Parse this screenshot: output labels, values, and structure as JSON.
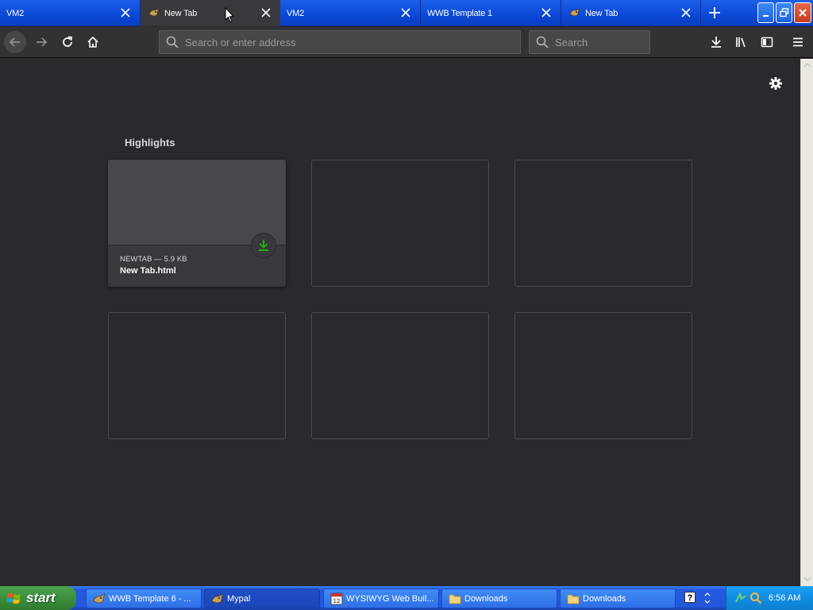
{
  "browser": {
    "tabs": [
      {
        "label": "VM2",
        "icon": null
      },
      {
        "label": "New Tab",
        "icon": "mypal-icon",
        "active": true
      },
      {
        "label": "VM2",
        "icon": null
      },
      {
        "label": "WWB Template 1",
        "icon": null
      },
      {
        "label": "New Tab",
        "icon": "mypal-icon"
      }
    ],
    "new_tab_icon": "plus-icon",
    "window_controls": [
      "minimize-icon",
      "restore-icon",
      "close-icon"
    ],
    "nav": {
      "url_placeholder": "Search or enter address",
      "search_placeholder": "Search"
    }
  },
  "newtab": {
    "section_title": "Highlights",
    "cards": [
      {
        "meta": "NEWTAB — 5.9 KB",
        "title": "New Tab.html",
        "badge_icon": "download-icon",
        "badge_color": "#12bc00"
      }
    ]
  },
  "taskbar": {
    "start_label": "start",
    "items": [
      {
        "label": "WWB Template 6 - ...",
        "icon": "mypal-icon"
      },
      {
        "label": "Mypal",
        "icon": "mypal-icon",
        "active": true
      },
      {
        "label": "WYSIWYG Web Buil...",
        "icon": "wysiwyg-icon"
      },
      {
        "label": "Downloads",
        "icon": "folder-icon"
      },
      {
        "label": "Downloads",
        "icon": "folder-icon"
      }
    ],
    "help_label": "?",
    "clock": "6:56 AM"
  },
  "colors": {
    "content_bg": "#2a2a2e",
    "toolbar_bg": "#323234",
    "xp_blue": "#2356d9",
    "start_green": "#3c8f3c",
    "download_green": "#12bc00"
  }
}
